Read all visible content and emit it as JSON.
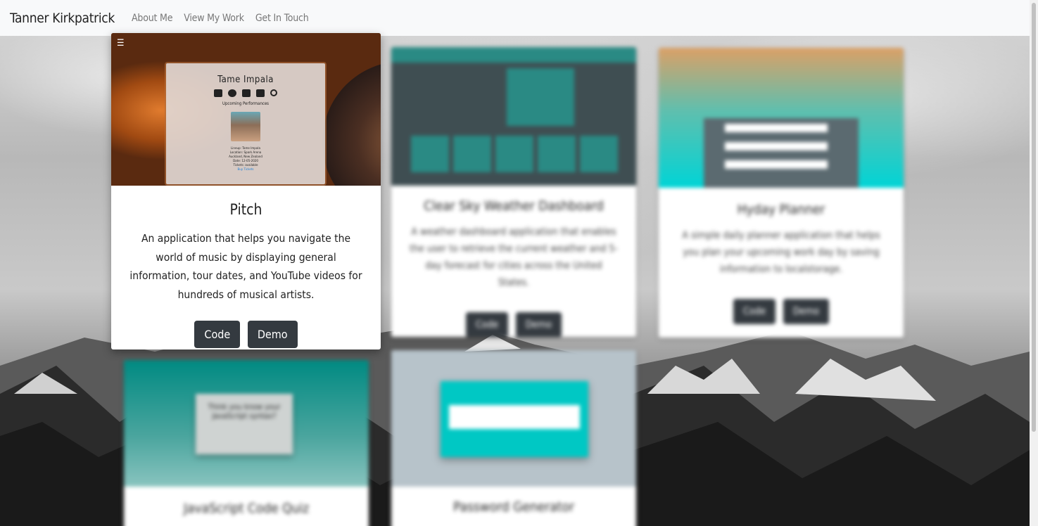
{
  "navbar": {
    "brand": "Tanner Kirkpatrick",
    "links": [
      "About Me",
      "View My Work",
      "Get In Touch"
    ]
  },
  "cards": {
    "pitch": {
      "title": "Pitch",
      "description": "An application that helps you navigate the world of music by displaying general information, tour dates, and YouTube videos for hundreds of musical artists.",
      "code_label": "Code",
      "demo_label": "Demo",
      "preview": {
        "artist": "Tame Impala",
        "subtitle": "Upcoming Performances",
        "lines": [
          "Lineup: Tame Impala",
          "Location: Spark Arena",
          "Auckland, New Zealand",
          "Date: 12-05-2020",
          "Tickets: available",
          "Buy Tickets"
        ]
      }
    },
    "weather": {
      "title": "Clear Sky Weather Dashboard",
      "description": "A weather dashboard application that enables the user to retrieve the current weather and 5-day forecast for cities across the United States.",
      "code_label": "Code",
      "demo_label": "Demo"
    },
    "planner": {
      "title": "Hyday Planner",
      "description": "A simple daily planner application that helps you plan your upcoming work day by saving information to localstorage.",
      "code_label": "Code",
      "demo_label": "Demo"
    },
    "quiz": {
      "title": "JavaScript Code Quiz",
      "preview_text": "Think you know your JavaScript syntax?"
    },
    "password": {
      "title": "Password Generator"
    }
  },
  "colors": {
    "navbar_bg": "#f8f9fa",
    "button_bg": "#343a40",
    "teal": "#2a8a84"
  }
}
